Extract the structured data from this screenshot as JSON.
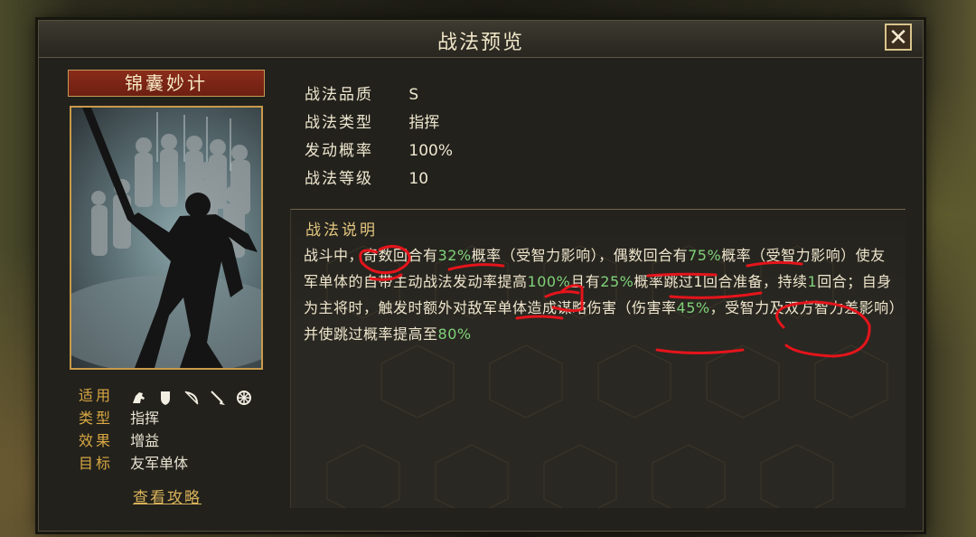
{
  "dialog": {
    "title": "战法预览",
    "close_icon": "close-icon"
  },
  "skill": {
    "name": "锦囊妙计",
    "portrait": "warrior-silhouette-image"
  },
  "attrs": {
    "applicable_label": "适用",
    "applicable_icons": [
      "cavalry-icon",
      "shield-icon",
      "bow-icon",
      "spear-icon",
      "wheel-icon"
    ],
    "type_label": "类型",
    "type_value": "指挥",
    "effect_label": "效果",
    "effect_value": "增益",
    "target_label": "目标",
    "target_value": "友军单体"
  },
  "guide_link": "查看攻略",
  "props": [
    {
      "label": "战法品质",
      "value": "S"
    },
    {
      "label": "战法类型",
      "value": "指挥"
    },
    {
      "label": "发动概率",
      "value": "100%"
    },
    {
      "label": "战法等级",
      "value": "10"
    }
  ],
  "description": {
    "title": "战法说明",
    "segments": [
      {
        "text": "战斗中，奇数回合有"
      },
      {
        "text": "32%",
        "hl": true
      },
      {
        "text": "概率（受智力影响），偶数回合有"
      },
      {
        "text": "75%",
        "hl": true
      },
      {
        "text": "概率（受智力影响）使友军单体的自带主动战法发动率提高"
      },
      {
        "text": "100%",
        "hl": true
      },
      {
        "text": "且有"
      },
      {
        "text": "25%",
        "hl": true
      },
      {
        "text": "概率跳过1回合准备，持续"
      },
      {
        "text": "1",
        "hl": true
      },
      {
        "text": "回合；自身为主将时，触发时额外对敌军单体造成谋略伤害（伤害率"
      },
      {
        "text": "45%",
        "hl": true
      },
      {
        "text": "，受智力及双方智力差影响）并使跳过概率提高至"
      },
      {
        "text": "80%",
        "hl": true
      }
    ]
  },
  "colors": {
    "gold": "#d9a843",
    "highlight": "#7fd27a",
    "annotation": "#e5141b",
    "plate_red": "#7a2415"
  }
}
